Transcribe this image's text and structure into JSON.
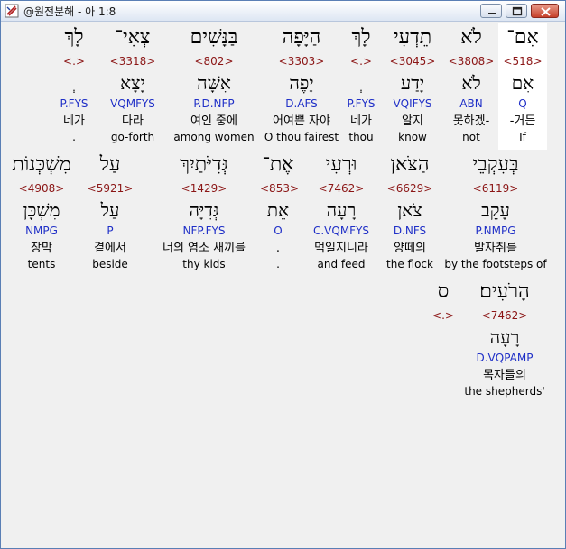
{
  "window": {
    "title": "@원전분해 - 아 1:8",
    "controls": {
      "minimize_icon": "minimize-icon",
      "maximize_icon": "maximize-icon",
      "close_icon": "close-icon"
    }
  },
  "rows": [
    [
      {
        "heb": "אִם־",
        "num": "<518>",
        "lex": "אִם",
        "parse": "Q",
        "kor": "-거든",
        "eng": "If",
        "selected": true
      },
      {
        "heb": "לֹא",
        "num": "<3808>",
        "lex": "לֹא",
        "parse": "ABN",
        "kor": "못하겠-",
        "eng": "not"
      },
      {
        "heb": "תֵדְעִי",
        "num": "<3045>",
        "lex": "יָדַע",
        "parse": "VQIFYS",
        "kor": "알지",
        "eng": "know"
      },
      {
        "heb": "לָךְ",
        "num": "<.>",
        "lex": "ְ",
        "parse": "P.FYS",
        "kor": "네가",
        "eng": "thou"
      },
      {
        "heb": "הַיָּפָה",
        "num": "<3303>",
        "lex": "יָפֶה",
        "parse": "D.AFS",
        "kor": "어여쁜 자야",
        "eng": "O thou fairest"
      },
      {
        "heb": "בַּנָּשִׁים",
        "num": "<802>",
        "lex": "אִשָּׁה",
        "parse": "P.D.NFP",
        "kor": "여인 중에",
        "eng": "among women"
      },
      {
        "heb": "צְאִי־",
        "num": "<3318>",
        "lex": "יָצָא",
        "parse": "VQMFYS",
        "kor": "다라",
        "eng": "go-forth"
      },
      {
        "heb": "לָךְ",
        "num": "<.>",
        "lex": "ְ",
        "parse": "P.FYS",
        "kor": "네가",
        "eng": "."
      }
    ],
    [
      {
        "heb": "בְּעִקְבֵי",
        "num": "<6119>",
        "lex": "עָקֵב",
        "parse": "P.NMPG",
        "kor": "발자취를",
        "eng": "by the footsteps of"
      },
      {
        "heb": "הַצֹּאן",
        "num": "<6629>",
        "lex": "צֹאן",
        "parse": "D.NFS",
        "kor": "양떼의",
        "eng": "the flock"
      },
      {
        "heb": "וּרְעִי",
        "num": "<7462>",
        "lex": "רָעָה",
        "parse": "C.VQMFYS",
        "kor": "먹일지니라",
        "eng": "and feed"
      },
      {
        "heb": "אֶת־",
        "num": "<853>",
        "lex": "אֵת",
        "parse": "O",
        "kor": ".",
        "eng": "."
      },
      {
        "heb": "גְּדִיֹּתַיִךְ",
        "num": "<1429>",
        "lex": "גְּדִיָּה",
        "parse": "NFP.FYS",
        "kor": "너의 염소 새끼를",
        "eng": "thy kids"
      },
      {
        "heb": "עַל",
        "num": "<5921>",
        "lex": "עַל",
        "parse": "P",
        "kor": "곁에서",
        "eng": "beside"
      },
      {
        "heb": "מִשְׁכְּנוֹת",
        "num": "<4908>",
        "lex": "מִשְׁכָּן",
        "parse": "NMPG",
        "kor": "장막",
        "eng": "tents"
      }
    ],
    [
      {
        "heb": "הָרֹעִים׃",
        "num": "<7462>",
        "lex": "רָעָה",
        "parse": "D.VQPAMP",
        "kor": "목자들의",
        "eng": "the shepherds'"
      },
      {
        "heb": "ס",
        "num": "<.>",
        "lex": "",
        "parse": "",
        "kor": "",
        "eng": ""
      }
    ]
  ]
}
